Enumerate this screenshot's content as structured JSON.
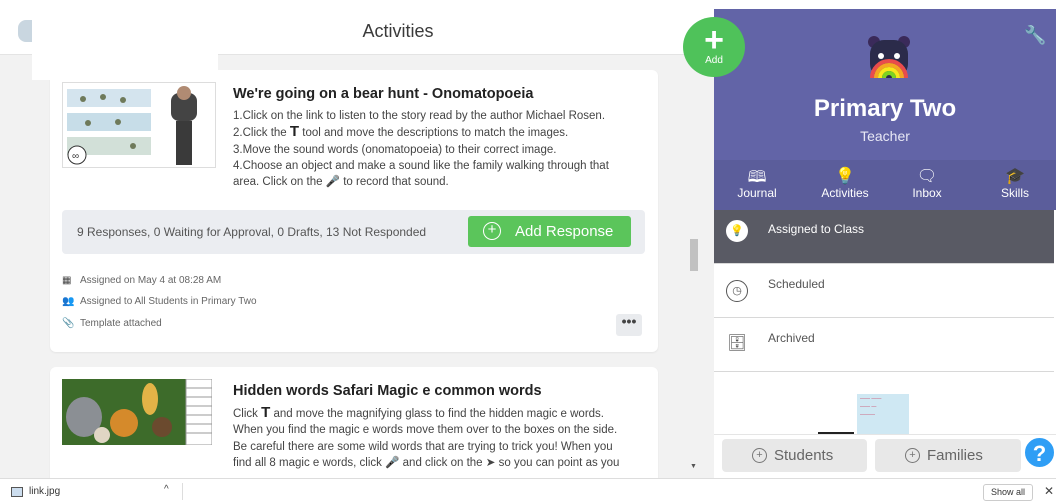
{
  "header": {
    "title": "Activities"
  },
  "fab": {
    "plus": "+",
    "label": "Add"
  },
  "activities": [
    {
      "title": "We're going on a bear hunt - Onomatopoeia",
      "lines": [
        "1.Click on the link to listen to the story read by the author Michael Rosen.",
        "2.Click the",
        "tool and move the descriptions to match the images.",
        "3.Move the sound words (onomatopoeia) to their correct image.",
        "4.Choose an object and make a sound like the family walking through that",
        "area. Click on the",
        "to record that sound."
      ],
      "responses": "9 Responses, 0 Waiting for Approval, 0 Drafts, 13 Not Responded",
      "add_response": "Add Response",
      "assigned_on": "Assigned on May 4 at 08:28 AM",
      "assigned_to": "Assigned to All Students in Primary Two",
      "template": "Template attached",
      "more": "•••"
    },
    {
      "title": "Hidden words Safari Magic e common words",
      "lines": [
        "Click",
        "and move the magnifying glass to find the hidden magic e words.",
        "When you find the magic e words move them over to the boxes on the side.",
        "Be careful there are some wild words that are trying to trick you! When you",
        "find all 8 magic e words, click",
        "and click on the",
        "so you can point as you"
      ]
    }
  ],
  "class_panel": {
    "name": "Primary Two",
    "role": "Teacher"
  },
  "tabs": [
    {
      "label": "Journal",
      "icon": "book-icon"
    },
    {
      "label": "Activities",
      "icon": "lightbulb-icon"
    },
    {
      "label": "Inbox",
      "icon": "chat-icon"
    },
    {
      "label": "Skills",
      "icon": "graduation-cap-icon"
    }
  ],
  "nav": [
    {
      "label": "Assigned to Class",
      "active": true
    },
    {
      "label": "Scheduled",
      "active": false
    },
    {
      "label": "Archived",
      "active": false
    }
  ],
  "bottom": {
    "students": "Students",
    "families": "Families",
    "help": "?"
  },
  "download_bar": {
    "file": "link.jpg",
    "show_all": "Show all",
    "close": "✕"
  },
  "colors": {
    "accent": "#6264a7",
    "add_green": "#5bc55b",
    "help_blue": "#2f9ef5"
  }
}
